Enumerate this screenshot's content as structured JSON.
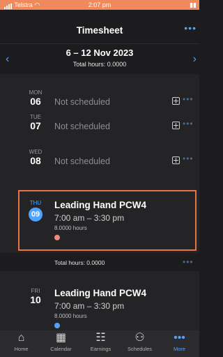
{
  "status_bar": {
    "carrier": "Telstra",
    "time": "2:07 pm"
  },
  "header": {
    "title": "Timesheet",
    "week_range": "6 – 12 Nov 2023",
    "total_hours": "Total hours: 0.0000",
    "prev_icon": "chevron-left-icon",
    "next_icon": "chevron-right-icon",
    "more_icon": "ellipsis-icon"
  },
  "days": [
    {
      "dow": "MON",
      "num": "06",
      "status": "Not scheduled"
    },
    {
      "dow": "TUE",
      "num": "07",
      "status": "Not scheduled"
    },
    {
      "dow": "WED",
      "num": "08",
      "status": "Not scheduled"
    }
  ],
  "shifts": [
    {
      "dow": "THU",
      "num": "09",
      "title": "Leading Hand PCW4",
      "time": "7:00 am – 3:30 pm",
      "hours": "8.0000 hours",
      "status_color": "#f08a7a",
      "selected": true
    },
    {
      "dow": "FRI",
      "num": "10",
      "title": "Leading Hand PCW4",
      "time": "7:00 am – 3:30 pm",
      "hours": "8.0000 hours",
      "status_color": "#4da3ff",
      "selected": false
    }
  ],
  "day_total": "Total hours: 0.0000",
  "tabs": [
    {
      "label": "Home",
      "icon": "home-icon"
    },
    {
      "label": "Calendar",
      "icon": "calendar-icon"
    },
    {
      "label": "Earnings",
      "icon": "earnings-icon"
    },
    {
      "label": "Schedules",
      "icon": "schedules-icon"
    },
    {
      "label": "More",
      "icon": "more-icon",
      "active": true
    }
  ],
  "colors": {
    "accent": "#4da3ff",
    "status_bar": "#f08a5d",
    "highlight_border": "#e8734a"
  }
}
